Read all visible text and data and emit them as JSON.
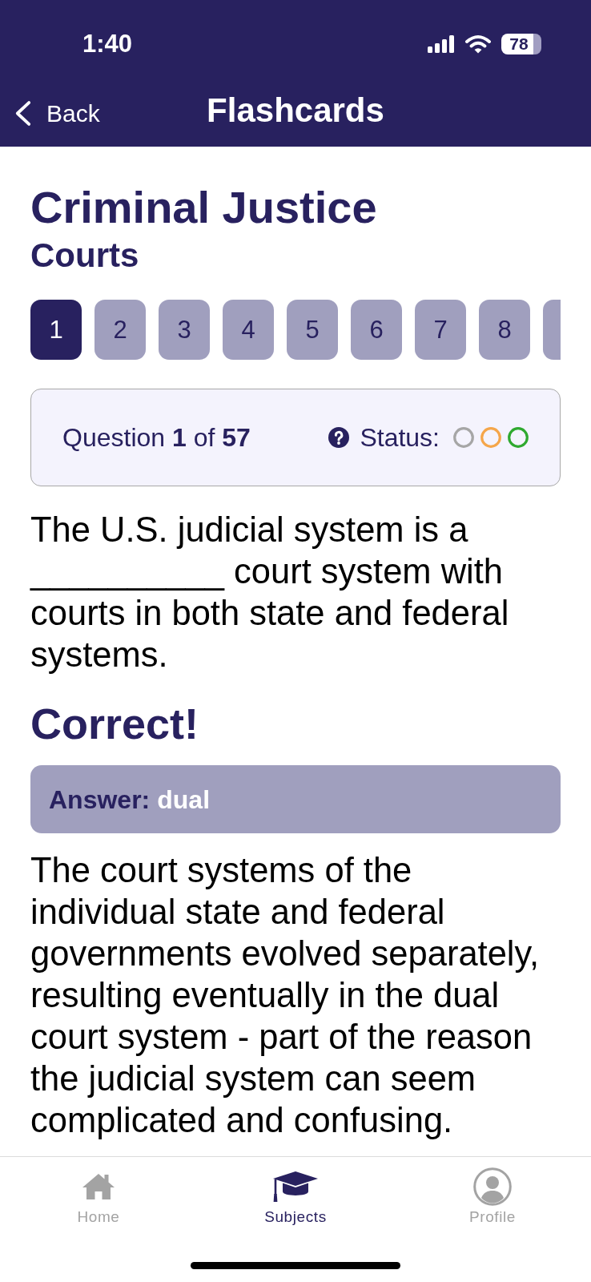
{
  "status_bar": {
    "time": "1:40",
    "battery": "78"
  },
  "nav": {
    "back": "Back",
    "title": "Flashcards"
  },
  "subject": {
    "title": "Criminal Justice",
    "subtitle": "Courts"
  },
  "question_pills": [
    {
      "label": "1",
      "selected": true
    },
    {
      "label": "2",
      "selected": false
    },
    {
      "label": "3",
      "selected": false
    },
    {
      "label": "4",
      "selected": false
    },
    {
      "label": "5",
      "selected": false
    },
    {
      "label": "6",
      "selected": false
    },
    {
      "label": "7",
      "selected": false
    },
    {
      "label": "8",
      "selected": false
    },
    {
      "selected": false
    }
  ],
  "question_card": {
    "counter": "Question **1** of **57**",
    "status_label": "Status:",
    "status_marks": [
      {
        "color": "#a6a6a6"
      },
      {
        "color": "#f5a64a"
      },
      {
        "color": "#2fa92f"
      }
    ]
  },
  "question": "The U.S. judicial system is a __________ court system with courts in both state and federal systems.",
  "result": "Correct!",
  "answer": {
    "label": "Answer:",
    "value": "dual"
  },
  "explanation": "The court systems of the individual state and federal governments evolved separately, resulting eventually in the dual court system - part of the reason the judicial system can seem complicated and confusing.",
  "tab_bar": [
    {
      "label": "Home",
      "kind": "home",
      "selected": false
    },
    {
      "label": "Subjects",
      "kind": "subjects",
      "selected": true
    },
    {
      "label": "Profile",
      "kind": "profile",
      "selected": false
    }
  ]
}
